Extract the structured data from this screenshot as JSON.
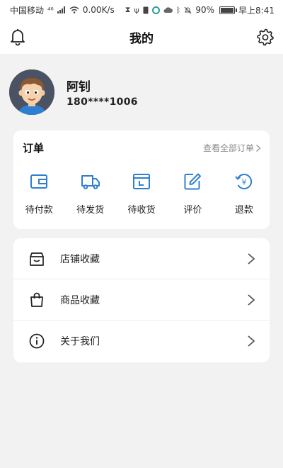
{
  "status_bar": {
    "carrier": "中国移动",
    "network": "⁴⁶",
    "speed": "0.00K/s",
    "battery": "90%",
    "battery_level": 0.9,
    "time": "早上8:41"
  },
  "header": {
    "title": "我的",
    "left_icon": "bell-icon",
    "right_icon": "gear-icon"
  },
  "profile": {
    "name": "阿钊",
    "phone": "180****1006"
  },
  "orders": {
    "title": "订单",
    "view_all": "查看全部订单",
    "items": [
      {
        "label": "待付款",
        "icon": "wallet-icon"
      },
      {
        "label": "待发货",
        "icon": "truck-icon"
      },
      {
        "label": "待收货",
        "icon": "box-icon"
      },
      {
        "label": "评价",
        "icon": "edit-icon"
      },
      {
        "label": "退款",
        "icon": "refund-icon"
      }
    ]
  },
  "menu": {
    "items": [
      {
        "label": "店铺收藏",
        "icon": "store-icon"
      },
      {
        "label": "商品收藏",
        "icon": "bag-icon"
      },
      {
        "label": "关于我们",
        "icon": "info-icon"
      }
    ]
  },
  "colors": {
    "accent": "#2f7fd1",
    "background": "#f2f2f2",
    "card": "#ffffff"
  }
}
